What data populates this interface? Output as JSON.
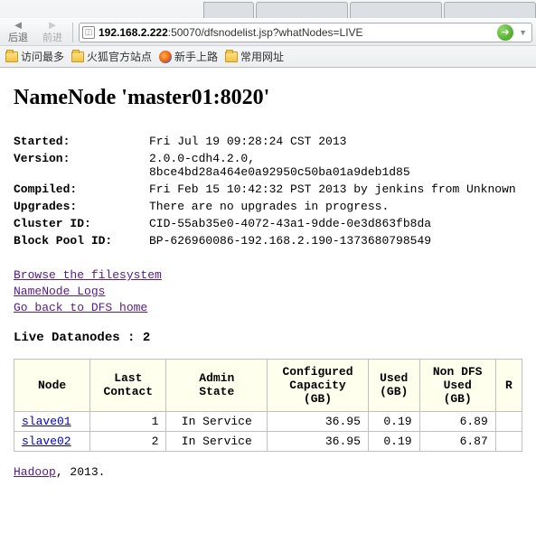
{
  "browser": {
    "back_label": "后退",
    "forward_label": "前进",
    "url_host": "192.168.2.222",
    "url_rest": ":50070/dfsnodelist.jsp?whatNodes=LIVE",
    "bookmarks": {
      "most_visited": "访问最多",
      "firefox_official": "火狐官方站点",
      "getting_started": "新手上路",
      "common_urls": "常用网址"
    }
  },
  "page": {
    "title_prefix": "NameNode '",
    "title_hostport": "master01:8020",
    "title_suffix": "'",
    "info": {
      "started_label": "Started:",
      "started_value": "Fri Jul 19 09:28:24 CST 2013",
      "version_label": "Version:",
      "version_value": "2.0.0-cdh4.2.0, 8bce4bd28a464e0a92950c50ba01a9deb1d85",
      "compiled_label": "Compiled:",
      "compiled_value": "Fri Feb 15 10:42:32 PST 2013 by jenkins from Unknown",
      "upgrades_label": "Upgrades:",
      "upgrades_value": "There are no upgrades in progress.",
      "cluster_id_label": "Cluster ID:",
      "cluster_id_value": "CID-55ab35e0-4072-43a1-9dde-0e3d863fb8da",
      "block_pool_id_label": "Block Pool ID:",
      "block_pool_id_value": "BP-626960086-192.168.2.190-1373680798549"
    },
    "links": {
      "browse": "Browse the filesystem",
      "logs": "NameNode Logs",
      "back": "Go back to DFS home"
    },
    "live_title": "Live Datanodes : 2",
    "table": {
      "headers": {
        "node": "Node",
        "last_contact": "Last\nContact",
        "admin_state": "Admin\nState",
        "configured_capacity": "Configured\nCapacity\n(GB)",
        "used": "Used\n(GB)",
        "non_dfs_used": "Non DFS\nUsed\n(GB)",
        "remaining": "R"
      },
      "rows": [
        {
          "node": "slave01",
          "last_contact": "1",
          "admin_state": "In Service",
          "configured_capacity": "36.95",
          "used": "0.19",
          "non_dfs_used": "6.89"
        },
        {
          "node": "slave02",
          "last_contact": "2",
          "admin_state": "In Service",
          "configured_capacity": "36.95",
          "used": "0.19",
          "non_dfs_used": "6.87"
        }
      ]
    },
    "footer_link": "Hadoop",
    "footer_rest": ", 2013."
  }
}
